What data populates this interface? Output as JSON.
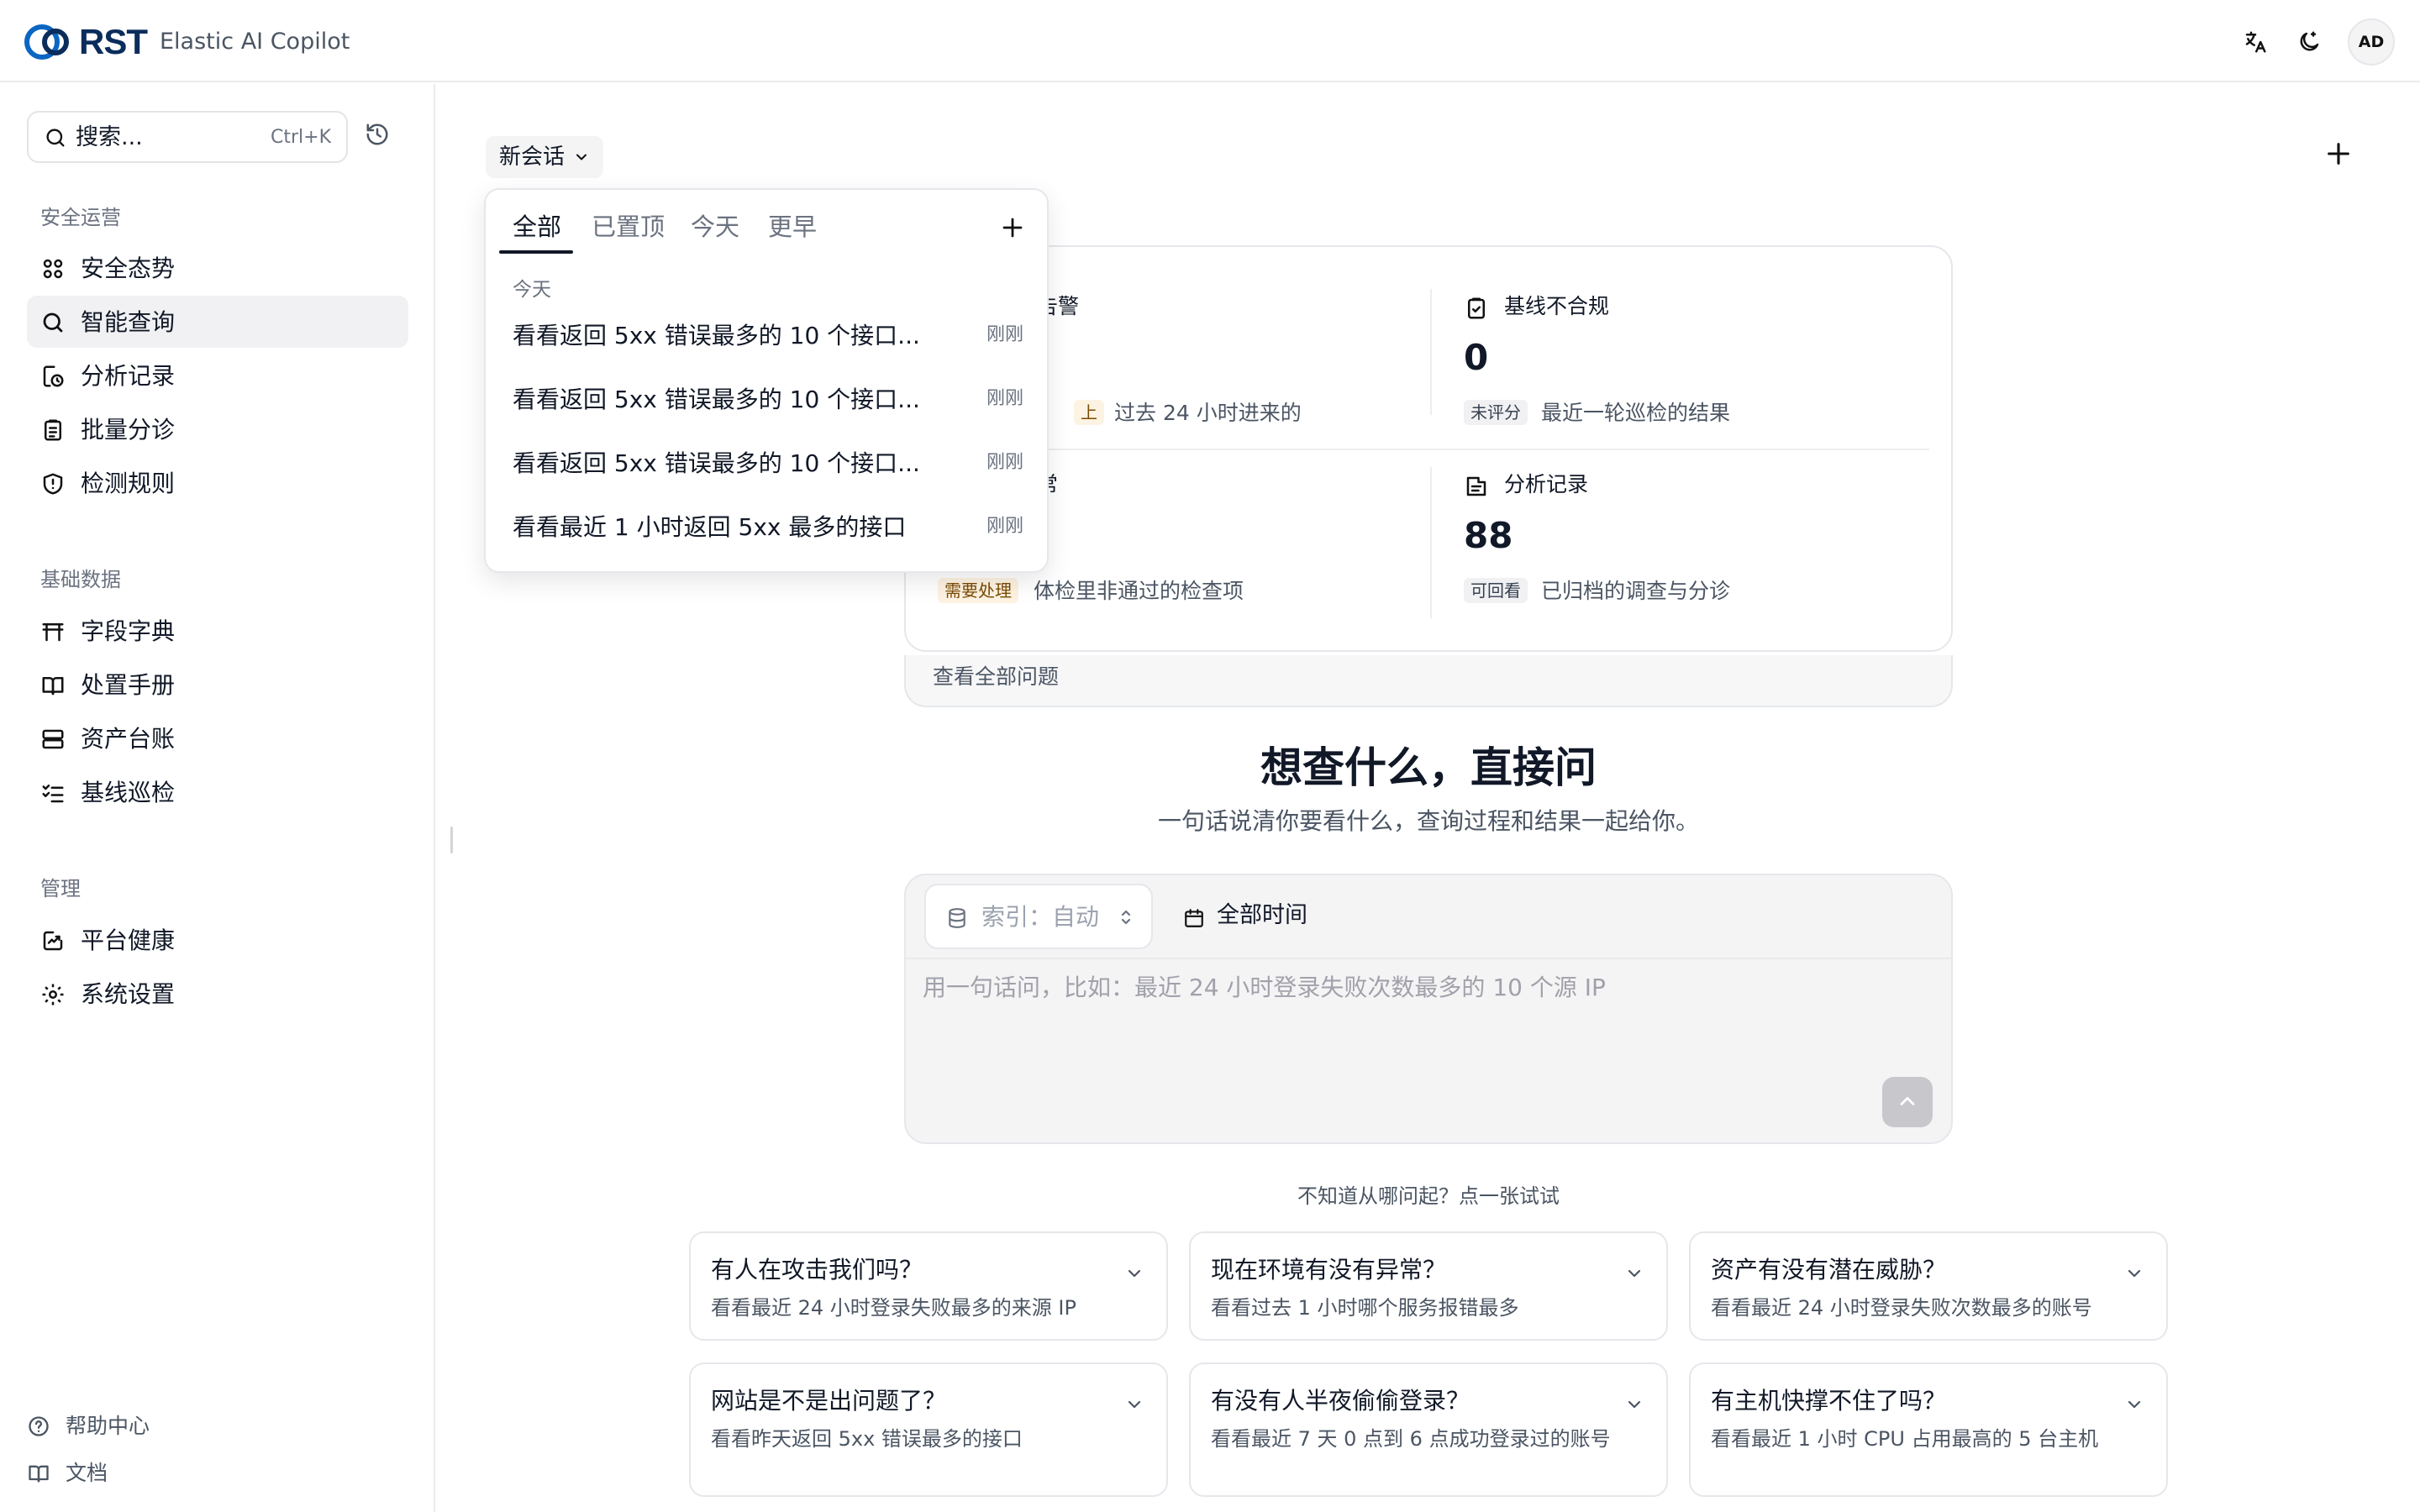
{
  "header": {
    "logo_text": "RST",
    "app_name": "Elastic AI Copilot",
    "avatar_initials": "AD",
    "brand_color": "#0b2d5c"
  },
  "sidebar": {
    "search_placeholder": "搜索...",
    "search_shortcut": "Ctrl+K",
    "sections": [
      {
        "title": "安全运营",
        "items": [
          {
            "label": "安全态势",
            "icon": "grid-icon"
          },
          {
            "label": "智能查询",
            "icon": "search-icon",
            "active": true
          },
          {
            "label": "分析记录",
            "icon": "history-file-icon"
          },
          {
            "label": "批量分诊",
            "icon": "clipboard-icon"
          },
          {
            "label": "检测规则",
            "icon": "shield-alert-icon"
          }
        ]
      },
      {
        "title": "基础数据",
        "items": [
          {
            "label": "字段字典",
            "icon": "table-icon"
          },
          {
            "label": "处置手册",
            "icon": "book-icon"
          },
          {
            "label": "资产台账",
            "icon": "server-icon"
          },
          {
            "label": "基线巡检",
            "icon": "checklist-icon"
          }
        ]
      },
      {
        "title": "管理",
        "items": [
          {
            "label": "平台健康",
            "icon": "activity-icon"
          },
          {
            "label": "系统设置",
            "icon": "gear-icon"
          }
        ]
      }
    ],
    "footer": [
      {
        "label": "帮助中心",
        "icon": "help-circle-icon"
      },
      {
        "label": "文档",
        "icon": "book-open-icon"
      }
    ]
  },
  "session": {
    "label": "新会话"
  },
  "dropdown": {
    "tabs": [
      "全部",
      "已置顶",
      "今天",
      "更早"
    ],
    "group": "今天",
    "items": [
      {
        "title": "看看返回 5xx 错误最多的 10 个接口...",
        "time": "刚刚"
      },
      {
        "title": "看看返回 5xx 错误最多的 10 个接口...",
        "time": "刚刚"
      },
      {
        "title": "看看返回 5xx 错误最多的 10 个接口...",
        "time": "刚刚"
      },
      {
        "title": "看看最近 1 小时返回 5xx 最多的接口",
        "time": "刚刚"
      }
    ]
  },
  "stats": {
    "alerts": {
      "title": "告警",
      "tag": "上",
      "desc": "过去 24 小时进来的"
    },
    "baseline": {
      "title": "基线不合规",
      "value": "0",
      "tag": "未评分",
      "desc": "最近一轮巡检的结果"
    },
    "health": {
      "title": "常",
      "tag": "需要处理",
      "desc": "体检里非通过的检查项"
    },
    "records": {
      "title": "分析记录",
      "value": "88",
      "tag": "可回看",
      "desc": "已归档的调查与分诊"
    },
    "view_all": "查看全部问题",
    "tag_warn_color": "#fdf3e2",
    "tag_neutral_color": "#f1f1f3"
  },
  "hero": {
    "title": "想查什么，直接问",
    "subtitle": "一句话说清你要看什么，查询过程和结果一起给你。"
  },
  "composer": {
    "index_label": "索引：自动",
    "time_label": "全部时间",
    "placeholder": "用一句话问，比如：最近 24 小时登录失败次数最多的 10 个源 IP"
  },
  "prompts": {
    "hint": "不知道从哪问起？点一张试试",
    "cards": [
      {
        "title": "有人在攻击我们吗？",
        "desc": "看看最近 24 小时登录失败最多的来源 IP"
      },
      {
        "title": "现在环境有没有异常？",
        "desc": "看看过去 1 小时哪个服务报错最多"
      },
      {
        "title": "资产有没有潜在威胁？",
        "desc": "看看最近 24 小时登录失败次数最多的账号"
      },
      {
        "title": "网站是不是出问题了？",
        "desc": "看看昨天返回 5xx 错误最多的接口"
      },
      {
        "title": "有没有人半夜偷偷登录？",
        "desc": "看看最近 7 天 0 点到 6 点成功登录过的账号"
      },
      {
        "title": "有主机快撑不住了吗？",
        "desc": "看看最近 1 小时 CPU 占用最高的 5 台主机"
      }
    ]
  }
}
